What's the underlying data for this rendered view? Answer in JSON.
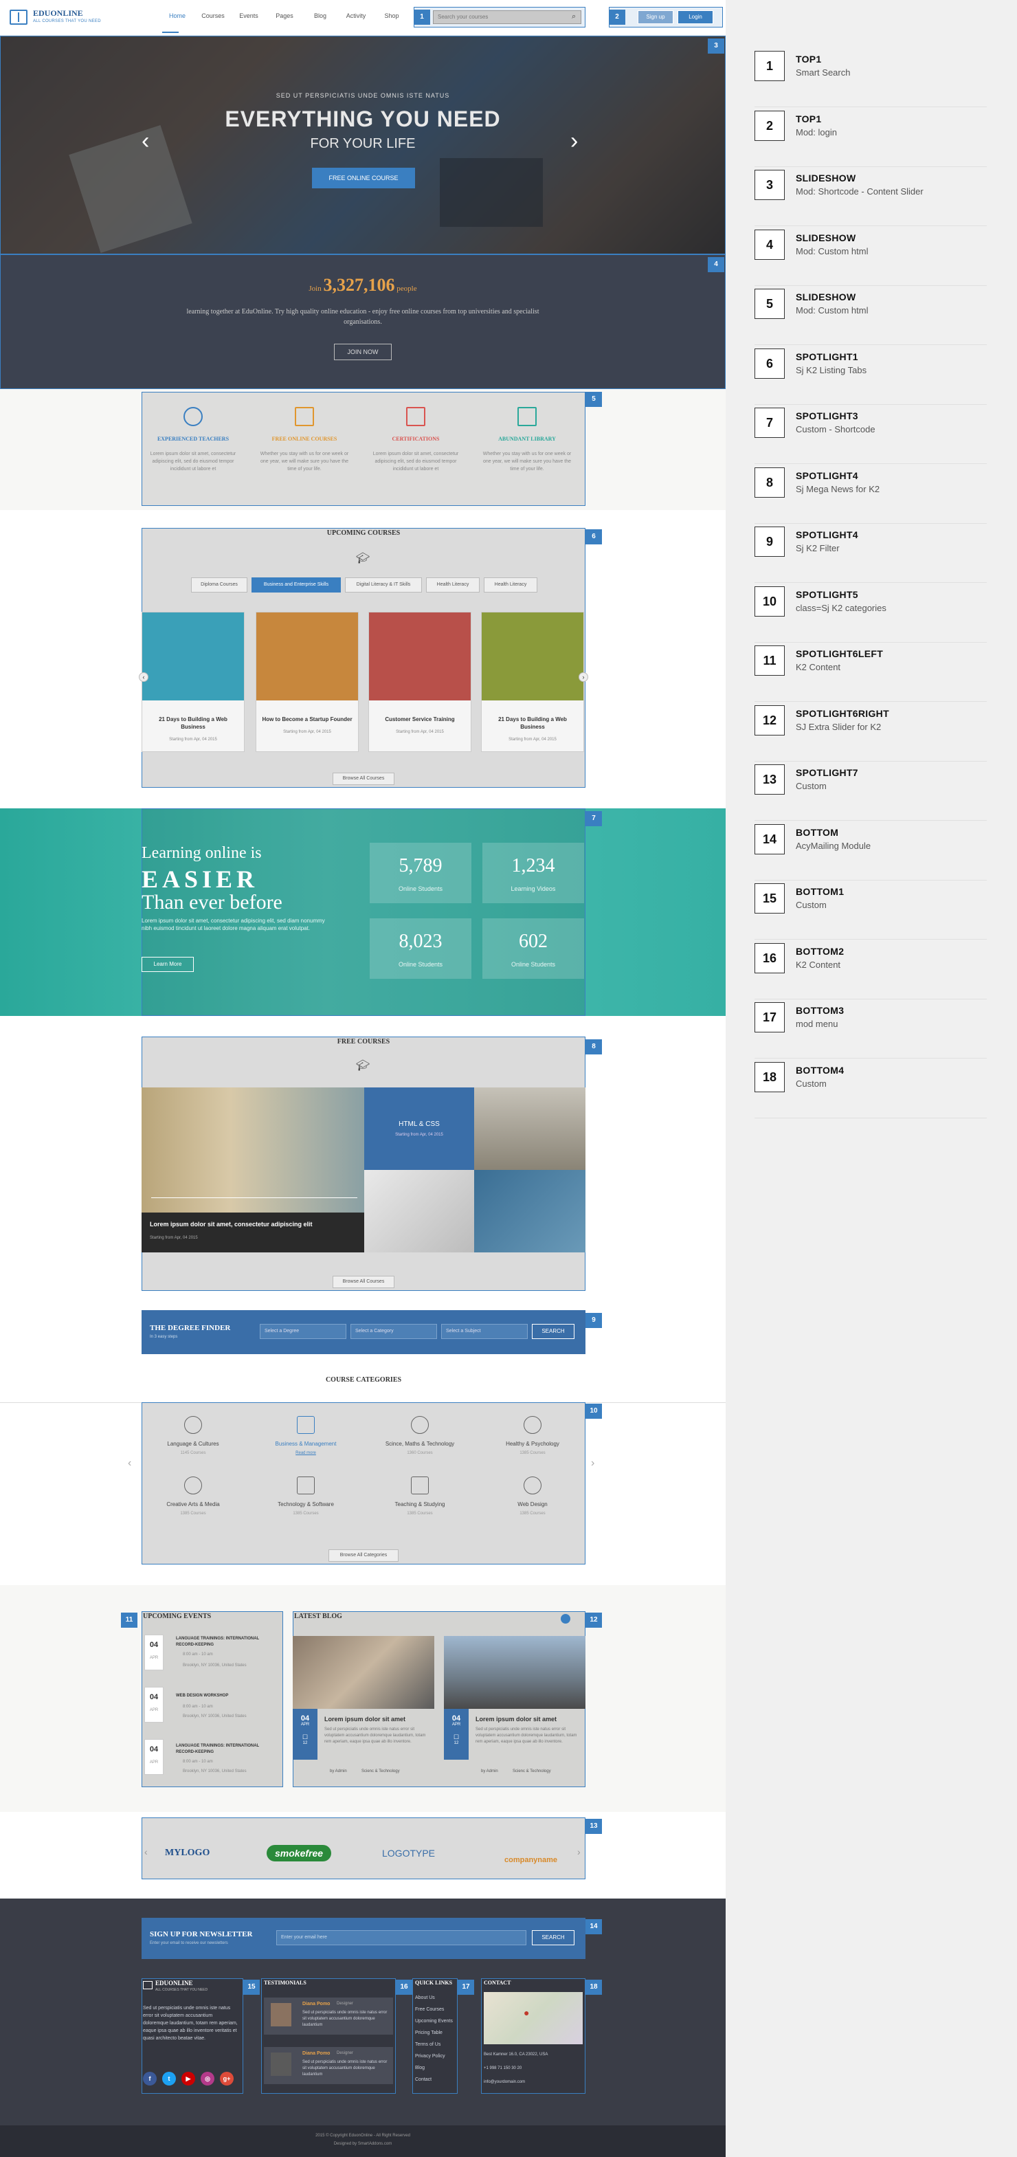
{
  "header": {
    "logo_name": "EDUONLINE",
    "logo_tagline": "ALL COURSES THAT YOU NEED",
    "nav": [
      "Home",
      "Courses",
      "Events",
      "Pages",
      "Blog",
      "Activity",
      "Shop"
    ],
    "search_placeholder": "Search your courses",
    "signup_label": "Sign up",
    "login_label": "Login"
  },
  "hero": {
    "subtitle": "SED UT PERSPICIATIS UNDE OMNIS ISTE NATUS",
    "title": "EVERYTHING YOU NEED",
    "title2": "FOR YOUR LIFE",
    "button": "FREE ONLINE COURSE"
  },
  "join": {
    "prefix": "Join",
    "count": "3,327,106",
    "suffix": "people",
    "text": "learning together at EduOnline. Try high quality online education - enjoy free online courses from top universities and specialist organisations.",
    "button": "JOIN NOW"
  },
  "features": [
    {
      "title": "EXPERIENCED TEACHERS",
      "desc": "Lorem ipsum dolor sit amet, consectetur adipiscing elit, sed do eiusmod tempor incididunt ut labore et",
      "color": "#3a7fc1"
    },
    {
      "title": "FREE ONLINE COURSES",
      "desc": "Whether you stay with us for one week or one year, we will make sure you have the time of your life.",
      "color": "#e0962e"
    },
    {
      "title": "CERTIFICATIONS",
      "desc": "Lorem ipsum dolor sit amet, consectetur adipiscing elit, sed do eiusmod tempor incididunt ut labore et",
      "color": "#d9534f"
    },
    {
      "title": "ABUNDANT LIBRARY",
      "desc": "Whether you stay with us for one week or one year, we will make sure you have the time of your life.",
      "color": "#2aa89a"
    }
  ],
  "upcoming": {
    "title": "UPCOMING COURSES",
    "tabs": [
      "Diploma Courses",
      "Business and Enterprise Skills",
      "Digital Literacy & IT Skills",
      "Health Literacy",
      "Health Literacy"
    ],
    "cards": [
      {
        "title": "21 Days to Building a Web Business",
        "meta": "Starting from Apr, 04 2015",
        "color": "#3aa0b8"
      },
      {
        "title": "How to Become a Startup Founder",
        "meta": "Starting from Apr, 04 2015",
        "color": "#c7873d"
      },
      {
        "title": "Customer Service Training",
        "meta": "Starting from Apr, 04 2015",
        "color": "#b8504a"
      },
      {
        "title": "21 Days to Building a Web Business",
        "meta": "Starting from Apr, 04 2015",
        "color": "#8a9a3a"
      }
    ],
    "browse": "Browse All Courses"
  },
  "teal": {
    "line1": "Learning online is",
    "line2": "EASIER",
    "line3": "Than ever before",
    "desc": "Lorem ipsum dolor sit amet, consectetur adipiscing elit, sed diam nonummy nibh euismod tincidunt ut laoreet dolore magna aliquam erat volutpat.",
    "button": "Learn More",
    "stats": [
      {
        "value": "5,789",
        "label": "Online Students"
      },
      {
        "value": "1,234",
        "label": "Learning Videos"
      },
      {
        "value": "8,023",
        "label": "Online Students"
      },
      {
        "value": "602",
        "label": "Online Students"
      }
    ]
  },
  "free_courses": {
    "title": "FREE COURSES",
    "video_title": "Lorem ipsum dolor sit amet, consectetur adipiscing elit",
    "video_meta": "Starting from Apr, 04 2015",
    "html_title": "HTML & CSS",
    "html_meta": "Starting from Apr, 04 2015",
    "browse": "Browse All Courses"
  },
  "degree": {
    "title": "THE DEGREE FINDER",
    "subtitle": "In 3 easy steps",
    "sel1": "Select a Degree",
    "sel2": "Select a Category",
    "sel3": "Select a Subject",
    "button": "SEARCH"
  },
  "categories": {
    "title": "COURSE CATEGORIES",
    "items": [
      {
        "name": "Language & Cultures",
        "count": "1145 Courses"
      },
      {
        "name": "Business & Management",
        "count": "Read more"
      },
      {
        "name": "Scince, Maths & Technology",
        "count": "1360 Courses"
      },
      {
        "name": "Healthy & Psychology",
        "count": "1385 Courses"
      },
      {
        "name": "Creative Arts & Media",
        "count": "1385 Courses"
      },
      {
        "name": "Technology & Software",
        "count": "1385 Courses"
      },
      {
        "name": "Teaching & Studying",
        "count": "1385 Courses"
      },
      {
        "name": "Web Design",
        "count": "1385 Courses"
      }
    ],
    "browse": "Browse All Categories"
  },
  "events": {
    "title": "UPCOMING EVENTS",
    "items": [
      {
        "day": "04",
        "month": "APR",
        "title": "LANGUAGE TRAININGS: INTERNATIONAL RECORD-KEEPING",
        "time": "8:00 am - 10 am",
        "place": "Brooklyn, NY 10036, United States"
      },
      {
        "day": "04",
        "month": "APR",
        "title": "WEB DESIGN WORKSHOP",
        "time": "8:00 am - 10 am",
        "place": "Brooklyn, NY 10036, United States"
      },
      {
        "day": "04",
        "month": "APR",
        "title": "LANGUAGE TRAININGS: INTERNATIONAL RECORD-KEEPING",
        "time": "8:00 am - 10 am",
        "place": "Brooklyn, NY 10036, United States"
      }
    ]
  },
  "blog": {
    "title": "LATEST BLOG",
    "posts": [
      {
        "day": "04",
        "month": "APR",
        "comments": "12",
        "title": "Lorem ipsum dolor sit amet",
        "text": "Sed ut perspiciatis unde omnis iste natus error sit voluptatem accusantium doloremque laudantium, totam rem aperiam, eaque ipsa quae ab illo inventore.",
        "author": "by Admin",
        "category": "Scienc & Technology"
      },
      {
        "day": "04",
        "month": "APR",
        "comments": "12",
        "title": "Lorem ipsum dolor sit amet",
        "text": "Sed ut perspiciatis unde omnis iste natus error sit voluptatem accusantium doloremque laudantium, totam rem aperiam, eaque ipsa quae ab illo inventore.",
        "author": "by Admin",
        "category": "Scienc & Technology"
      }
    ]
  },
  "logos": [
    "MYLOGO",
    "smokefree",
    "LOGOTYPE",
    "companyname"
  ],
  "newsletter": {
    "title": "SIGN UP FOR NEWSLETTER",
    "subtitle": "Enter your email to receive our newsletters",
    "placeholder": "Enter your email here",
    "button": "SEARCH"
  },
  "footer": {
    "logo_name": "EDUONLINE",
    "logo_tagline": "ALL COURSES THAT YOU NEED",
    "about": "Sed ut perspiciatis unde omnis iste natus error sit voluptatem accusantium doloremque laudantium, totam rem aperiam, eaque ipsa quae ab illo inventore veritatis et quasi architecto beatae vitae.",
    "testimonials_title": "TESTIMONIALS",
    "testimonials": [
      {
        "name": "Diana Pomo",
        "role": "Designer",
        "quote": "Sed ut perspiciatis unde omnis iste natus error sit voluptatem accusantium doloremque laudantium"
      },
      {
        "name": "Diana Pomo",
        "role": "Designer",
        "quote": "Sed ut perspiciatis unde omnis iste natus error sit voluptatem accusantium doloremque laudantium"
      }
    ],
    "links_title": "QUICK LINKS",
    "links": [
      "About Us",
      "Free Courses",
      "Upcoming Events",
      "Pricing Table",
      "Terms of Us",
      "Privacy Policy",
      "Blog",
      "Contact"
    ],
    "contact_title": "CONTACT",
    "address": "Best Kamner 16.0, CA 23022, USA",
    "phone": "+1 998 71 150 30 20",
    "email": "info@yourdomain.com",
    "copyright": "2015 © Copyright EduonOnline - All Right Reserved",
    "designed": "Designed by SmartAddons.com"
  },
  "legend": [
    {
      "num": "1",
      "title": "TOP1",
      "sub": "Smart Search"
    },
    {
      "num": "2",
      "title": "TOP1",
      "sub": "Mod: login"
    },
    {
      "num": "3",
      "title": "SLIDESHOW",
      "sub": "Mod: Shortcode - Content Slider"
    },
    {
      "num": "4",
      "title": "SLIDESHOW",
      "sub": "Mod: Custom html"
    },
    {
      "num": "5",
      "title": "SLIDESHOW",
      "sub": "Mod: Custom html"
    },
    {
      "num": "6",
      "title": "SPOTLIGHT1",
      "sub": "Sj K2 Listing Tabs"
    },
    {
      "num": "7",
      "title": "SPOTLIGHT3",
      "sub": "Custom - Shortcode"
    },
    {
      "num": "8",
      "title": "SPOTLIGHT4",
      "sub": "Sj Mega News for K2"
    },
    {
      "num": "9",
      "title": "SPOTLIGHT4",
      "sub": "Sj K2 Filter"
    },
    {
      "num": "10",
      "title": "SPOTLIGHT5",
      "sub": "class=Sj K2 categories"
    },
    {
      "num": "11",
      "title": "SPOTLIGHT6LEFT",
      "sub": "K2 Content"
    },
    {
      "num": "12",
      "title": "SPOTLIGHT6RIGHT",
      "sub": "SJ Extra Slider for K2"
    },
    {
      "num": "13",
      "title": "SPOTLIGHT7",
      "sub": "Custom"
    },
    {
      "num": "14",
      "title": "BOTTOM",
      "sub": "AcyMailing Module"
    },
    {
      "num": "15",
      "title": "BOTTOM1",
      "sub": "Custom"
    },
    {
      "num": "16",
      "title": "BOTTOM2",
      "sub": "K2 Content"
    },
    {
      "num": "17",
      "title": "BOTTOM3",
      "sub": "mod menu"
    },
    {
      "num": "18",
      "title": "BOTTOM4",
      "sub": "Custom"
    }
  ],
  "tags": [
    "1",
    "2",
    "3",
    "4",
    "5",
    "6",
    "7",
    "8",
    "9",
    "10",
    "11",
    "12",
    "13",
    "14",
    "15",
    "16",
    "17",
    "18"
  ]
}
